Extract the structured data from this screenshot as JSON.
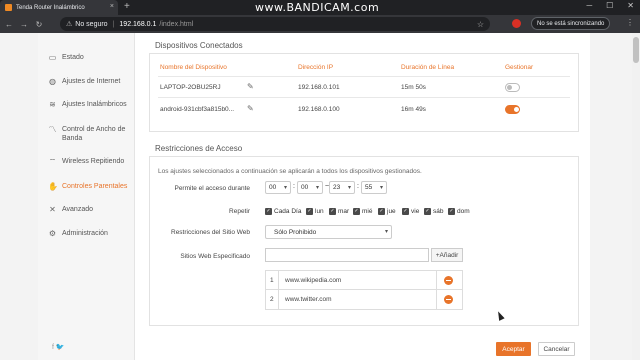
{
  "browser": {
    "tab_title": "Tenda Router Inalámbrico",
    "tab_close": "×",
    "new_tab": "+",
    "watermark": "www.BANDICAM.com",
    "security": "No seguro",
    "url_host": "192.168.0.1",
    "url_path": "/index.html",
    "sync_status": "No se está sincronizando"
  },
  "sidebar": {
    "items": [
      {
        "label": "Estado",
        "icon": "router-icon"
      },
      {
        "label": "Ajustes de Internet",
        "icon": "globe-icon"
      },
      {
        "label": "Ajustes Inalámbricos",
        "icon": "wifi-icon"
      },
      {
        "label": "Control de Ancho de Banda",
        "icon": "bandwidth-icon"
      },
      {
        "label": "Wireless Repitiendo",
        "icon": "repeater-icon"
      },
      {
        "label": "Controles Parentales",
        "icon": "parental-icon"
      },
      {
        "label": "Avanzado",
        "icon": "tools-icon"
      },
      {
        "label": "Administración",
        "icon": "gear-icon"
      }
    ],
    "active_index": 5,
    "social": "f  🐦"
  },
  "devices": {
    "title": "Dispositivos Conectados",
    "headers": {
      "name": "Nombre del Dispositivo",
      "ip": "Dirección IP",
      "duration": "Duración de Línea",
      "manage": "Gestionar"
    },
    "rows": [
      {
        "name": "LAPTOP-2OBU25RJ",
        "ip": "192.168.0.101",
        "duration": "15m 50s",
        "managed": false
      },
      {
        "name": "android-931cbf3a815b0...",
        "ip": "192.168.0.100",
        "duration": "16m 49s",
        "managed": true
      }
    ]
  },
  "restrictions": {
    "title": "Restricciones de Acceso",
    "note": "Los ajustes seleccionados a continuación se aplicarán a todos los dispositivos gestionados.",
    "access_label": "Permite el acceso durante",
    "time": {
      "start_h": "00",
      "start_m": "00",
      "end_h": "23",
      "end_m": "55"
    },
    "repeat_label": "Repetir",
    "days": [
      "Cada Día",
      "lun",
      "mar",
      "mié",
      "jue",
      "vie",
      "sáb",
      "dom"
    ],
    "site_restriction_label": "Restricciones del Sitio Web",
    "site_restriction_value": "Sólo Prohibido",
    "specified_label": "Sitios Web Especificado",
    "add_button": "+Añadir",
    "sites": [
      {
        "num": "1",
        "url": "www.wikipedia.com"
      },
      {
        "num": "2",
        "url": "www.twitter.com"
      }
    ]
  },
  "footer": {
    "accept": "Aceptar",
    "cancel": "Cancelar"
  }
}
